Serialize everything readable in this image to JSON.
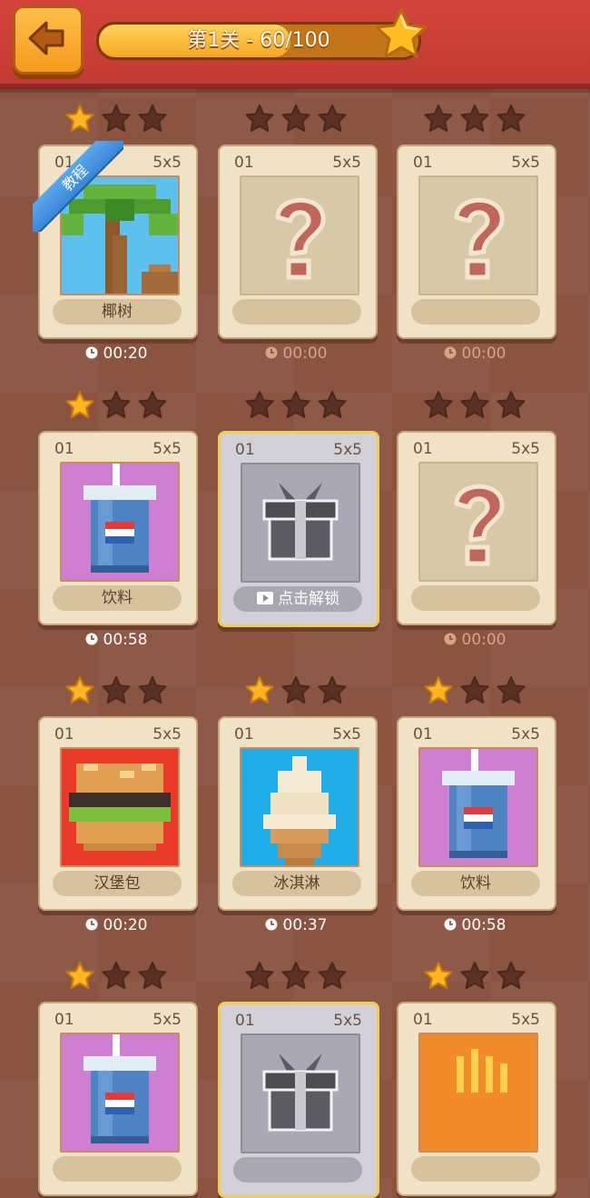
{
  "header": {
    "title": "第1关 - 60/100",
    "progress_fraction": 0.6
  },
  "icons": {
    "back": "back-arrow-icon",
    "star_filled": "star-filled-icon",
    "star_empty": "star-empty-icon",
    "clock": "clock-icon",
    "question": "question-mark-icon",
    "gift": "gift-icon",
    "video": "video-play-icon"
  },
  "colors": {
    "header": "#c23a33",
    "accent": "#f7a722",
    "star_filled": "#ffb51f",
    "star_empty": "#5a3225",
    "tutorial_ribbon": "#3a86d6"
  },
  "levels": [
    {
      "num": "01",
      "size": "5x5",
      "name": "椰树",
      "stars": 1,
      "time": "00:20",
      "state": "done",
      "art": "palm",
      "badge": "教程"
    },
    {
      "num": "01",
      "size": "5x5",
      "name": "",
      "stars": 0,
      "time": "00:00",
      "state": "unknown",
      "art": "question"
    },
    {
      "num": "01",
      "size": "5x5",
      "name": "",
      "stars": 0,
      "time": "00:00",
      "state": "unknown",
      "art": "question"
    },
    {
      "num": "01",
      "size": "5x5",
      "name": "饮料",
      "stars": 1,
      "time": "00:58",
      "state": "done",
      "art": "drink"
    },
    {
      "num": "01",
      "size": "5x5",
      "name": "点击解锁",
      "stars": 0,
      "time": "",
      "state": "locked",
      "art": "gift"
    },
    {
      "num": "01",
      "size": "5x5",
      "name": "",
      "stars": 0,
      "time": "00:00",
      "state": "unknown",
      "art": "question"
    },
    {
      "num": "01",
      "size": "5x5",
      "name": "汉堡包",
      "stars": 1,
      "time": "00:20",
      "state": "done",
      "art": "burger"
    },
    {
      "num": "01",
      "size": "5x5",
      "name": "冰淇淋",
      "stars": 1,
      "time": "00:37",
      "state": "done",
      "art": "icecream"
    },
    {
      "num": "01",
      "size": "5x5",
      "name": "饮料",
      "stars": 1,
      "time": "00:58",
      "state": "done",
      "art": "drink"
    },
    {
      "num": "01",
      "size": "5x5",
      "name": "",
      "stars": 1,
      "time": "",
      "state": "done",
      "art": "drink"
    },
    {
      "num": "01",
      "size": "5x5",
      "name": "",
      "stars": 0,
      "time": "",
      "state": "locked",
      "art": "gift"
    },
    {
      "num": "01",
      "size": "5x5",
      "name": "",
      "stars": 1,
      "time": "",
      "state": "done",
      "art": "fries"
    }
  ]
}
